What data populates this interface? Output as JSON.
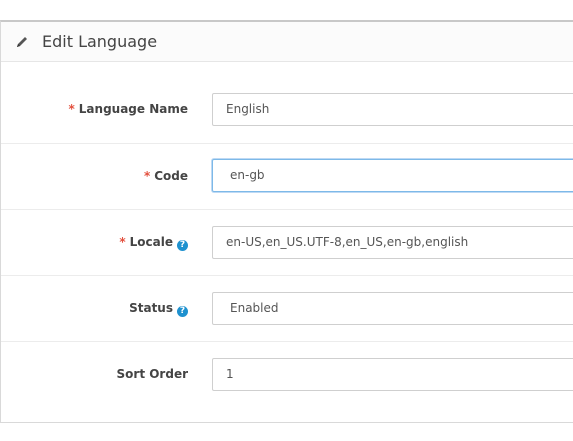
{
  "panel": {
    "title": "Edit Language"
  },
  "form": {
    "required_marker": "*",
    "help_glyph": "?",
    "fields": [
      {
        "label": "Language Name",
        "required": true,
        "help": false,
        "value": "English"
      },
      {
        "label": "Code",
        "required": true,
        "help": false,
        "value": "en-gb",
        "focused": true
      },
      {
        "label": "Locale",
        "required": true,
        "help": true,
        "value": "en-US,en_US.UTF-8,en_US,en-gb,english"
      },
      {
        "label": "Status",
        "required": false,
        "help": true,
        "value": "Enabled"
      },
      {
        "label": "Sort Order",
        "required": false,
        "help": false,
        "value": "1"
      }
    ]
  },
  "colors": {
    "required": "#e3503e",
    "help_icon": "#1e91cf",
    "focus_border": "#7db9e8"
  },
  "icons": {
    "heading": "pencil-icon",
    "help": "question-circle-icon"
  }
}
